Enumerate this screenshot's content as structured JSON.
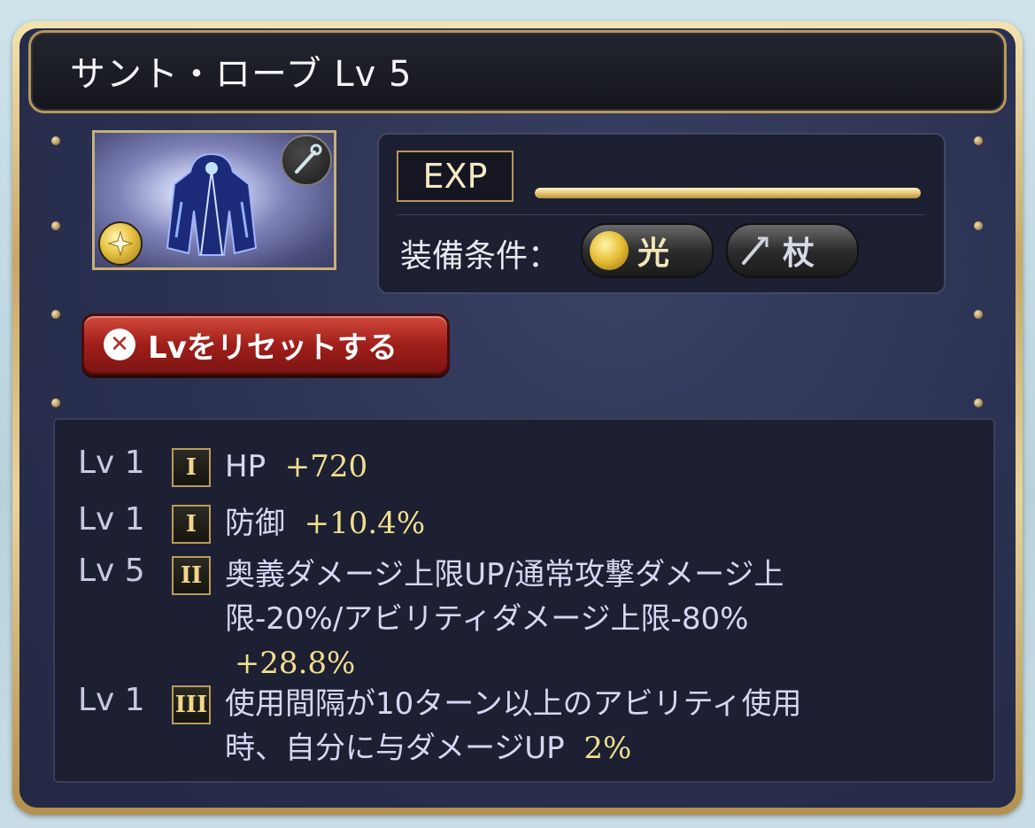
{
  "title": "サント・ローブ Lv 5",
  "exp": {
    "label": "EXP",
    "fill_fraction": 1.0
  },
  "conditions": {
    "label": "装備条件：",
    "element": {
      "icon": "light-element-icon",
      "label": "光"
    },
    "weapon": {
      "icon": "staff-icon",
      "label": "杖"
    }
  },
  "reset_button": {
    "icon": "close-icon",
    "label": "Lvをリセットする"
  },
  "skills": [
    {
      "level": "Lv 1",
      "tier": "I",
      "name": "HP",
      "value": "+720"
    },
    {
      "level": "Lv 1",
      "tier": "I",
      "name": "防御",
      "value": "+10.4%"
    },
    {
      "level": "Lv 5",
      "tier": "II",
      "name_line1": "奥義ダメージ上限UP/通常攻撃ダメージ上",
      "name_line2": "限-20%/アビリティダメージ上限-80%",
      "value": "+28.8%"
    },
    {
      "level": "Lv 1",
      "tier": "III",
      "name_line1": "使用間隔が10ターン以上のアビリティ使用",
      "name_line2": "時、自分に与ダメージUP",
      "value": "2%"
    }
  ],
  "colors": {
    "gold_frame": "#c9a764",
    "panel_bg": "#2a3050",
    "value_text": "#f1df8e",
    "reset_red": "#a01f1a"
  }
}
